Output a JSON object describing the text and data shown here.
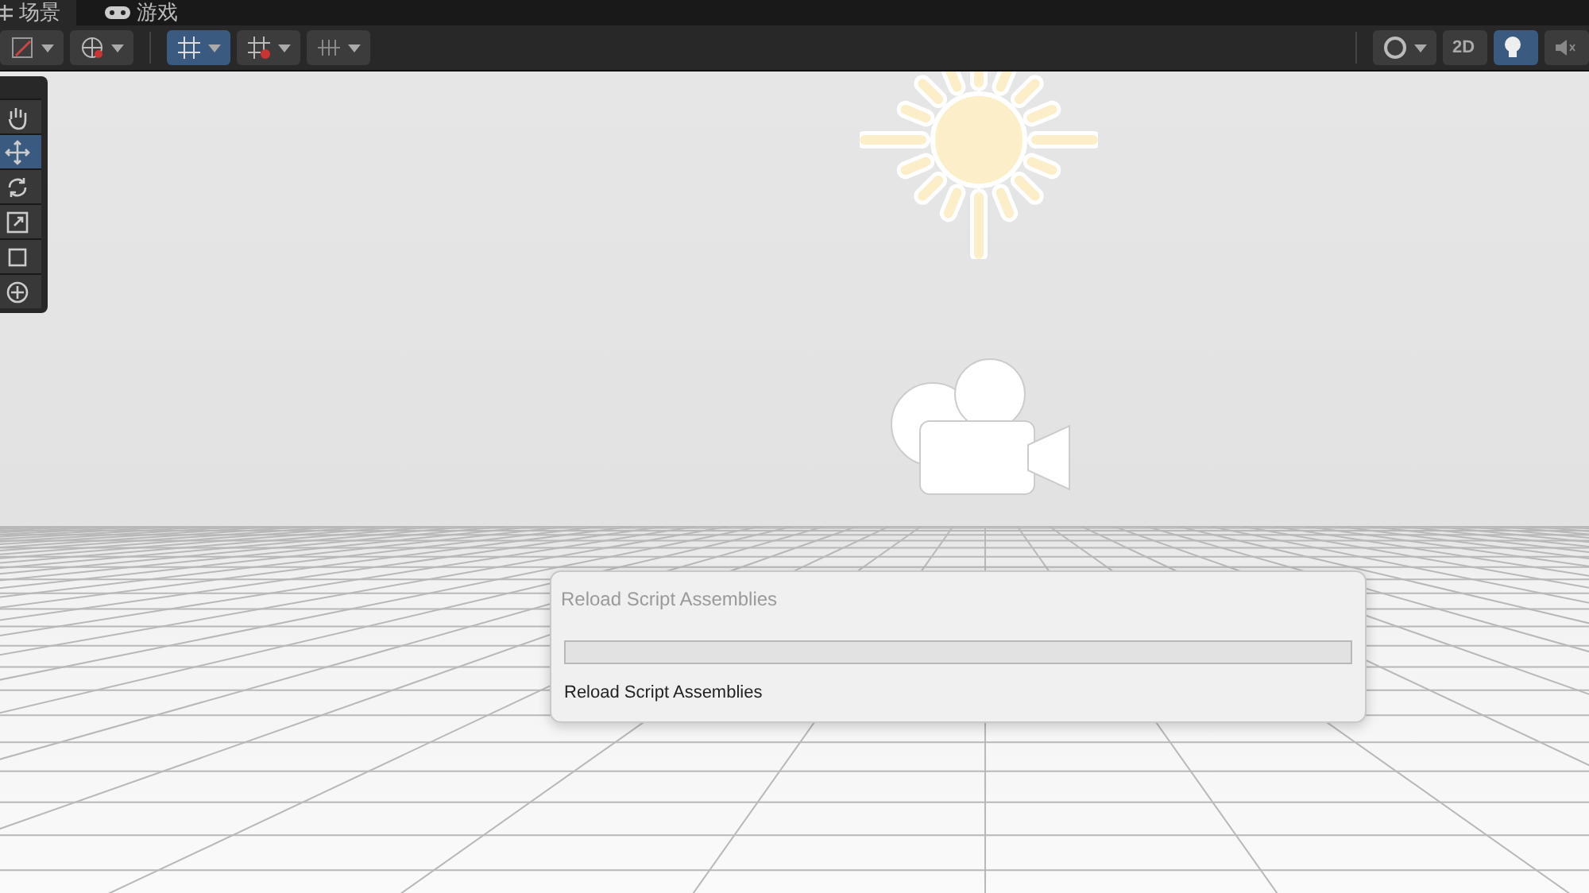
{
  "tabs": [
    {
      "label": "场景",
      "kind": "scene",
      "selected": true
    },
    {
      "label": "游戏",
      "kind": "game",
      "selected": false
    }
  ],
  "toolbar": {
    "left": [
      {
        "kind": "draw-mode",
        "selected": false
      },
      {
        "kind": "globe",
        "selected": false
      },
      {
        "kind": "grid-snap",
        "selected": true
      },
      {
        "kind": "snap-increment",
        "selected": false
      },
      {
        "kind": "grid-lines",
        "selected": false
      }
    ],
    "right": [
      {
        "kind": "shading",
        "selected": false
      },
      {
        "kind": "label",
        "label": "2D",
        "selected": false
      },
      {
        "kind": "lighting",
        "selected": true
      },
      {
        "kind": "audio",
        "selected": false
      }
    ]
  },
  "tools": [
    {
      "kind": "hand",
      "selected": false
    },
    {
      "kind": "move",
      "selected": true
    },
    {
      "kind": "rotate",
      "selected": false
    },
    {
      "kind": "scale",
      "selected": false
    },
    {
      "kind": "rect",
      "selected": false
    },
    {
      "kind": "transform",
      "selected": false
    }
  ],
  "dialog": {
    "title": "Reload Script Assemblies",
    "progress": {
      "level": 0
    },
    "message": "Reload Script Assemblies"
  }
}
